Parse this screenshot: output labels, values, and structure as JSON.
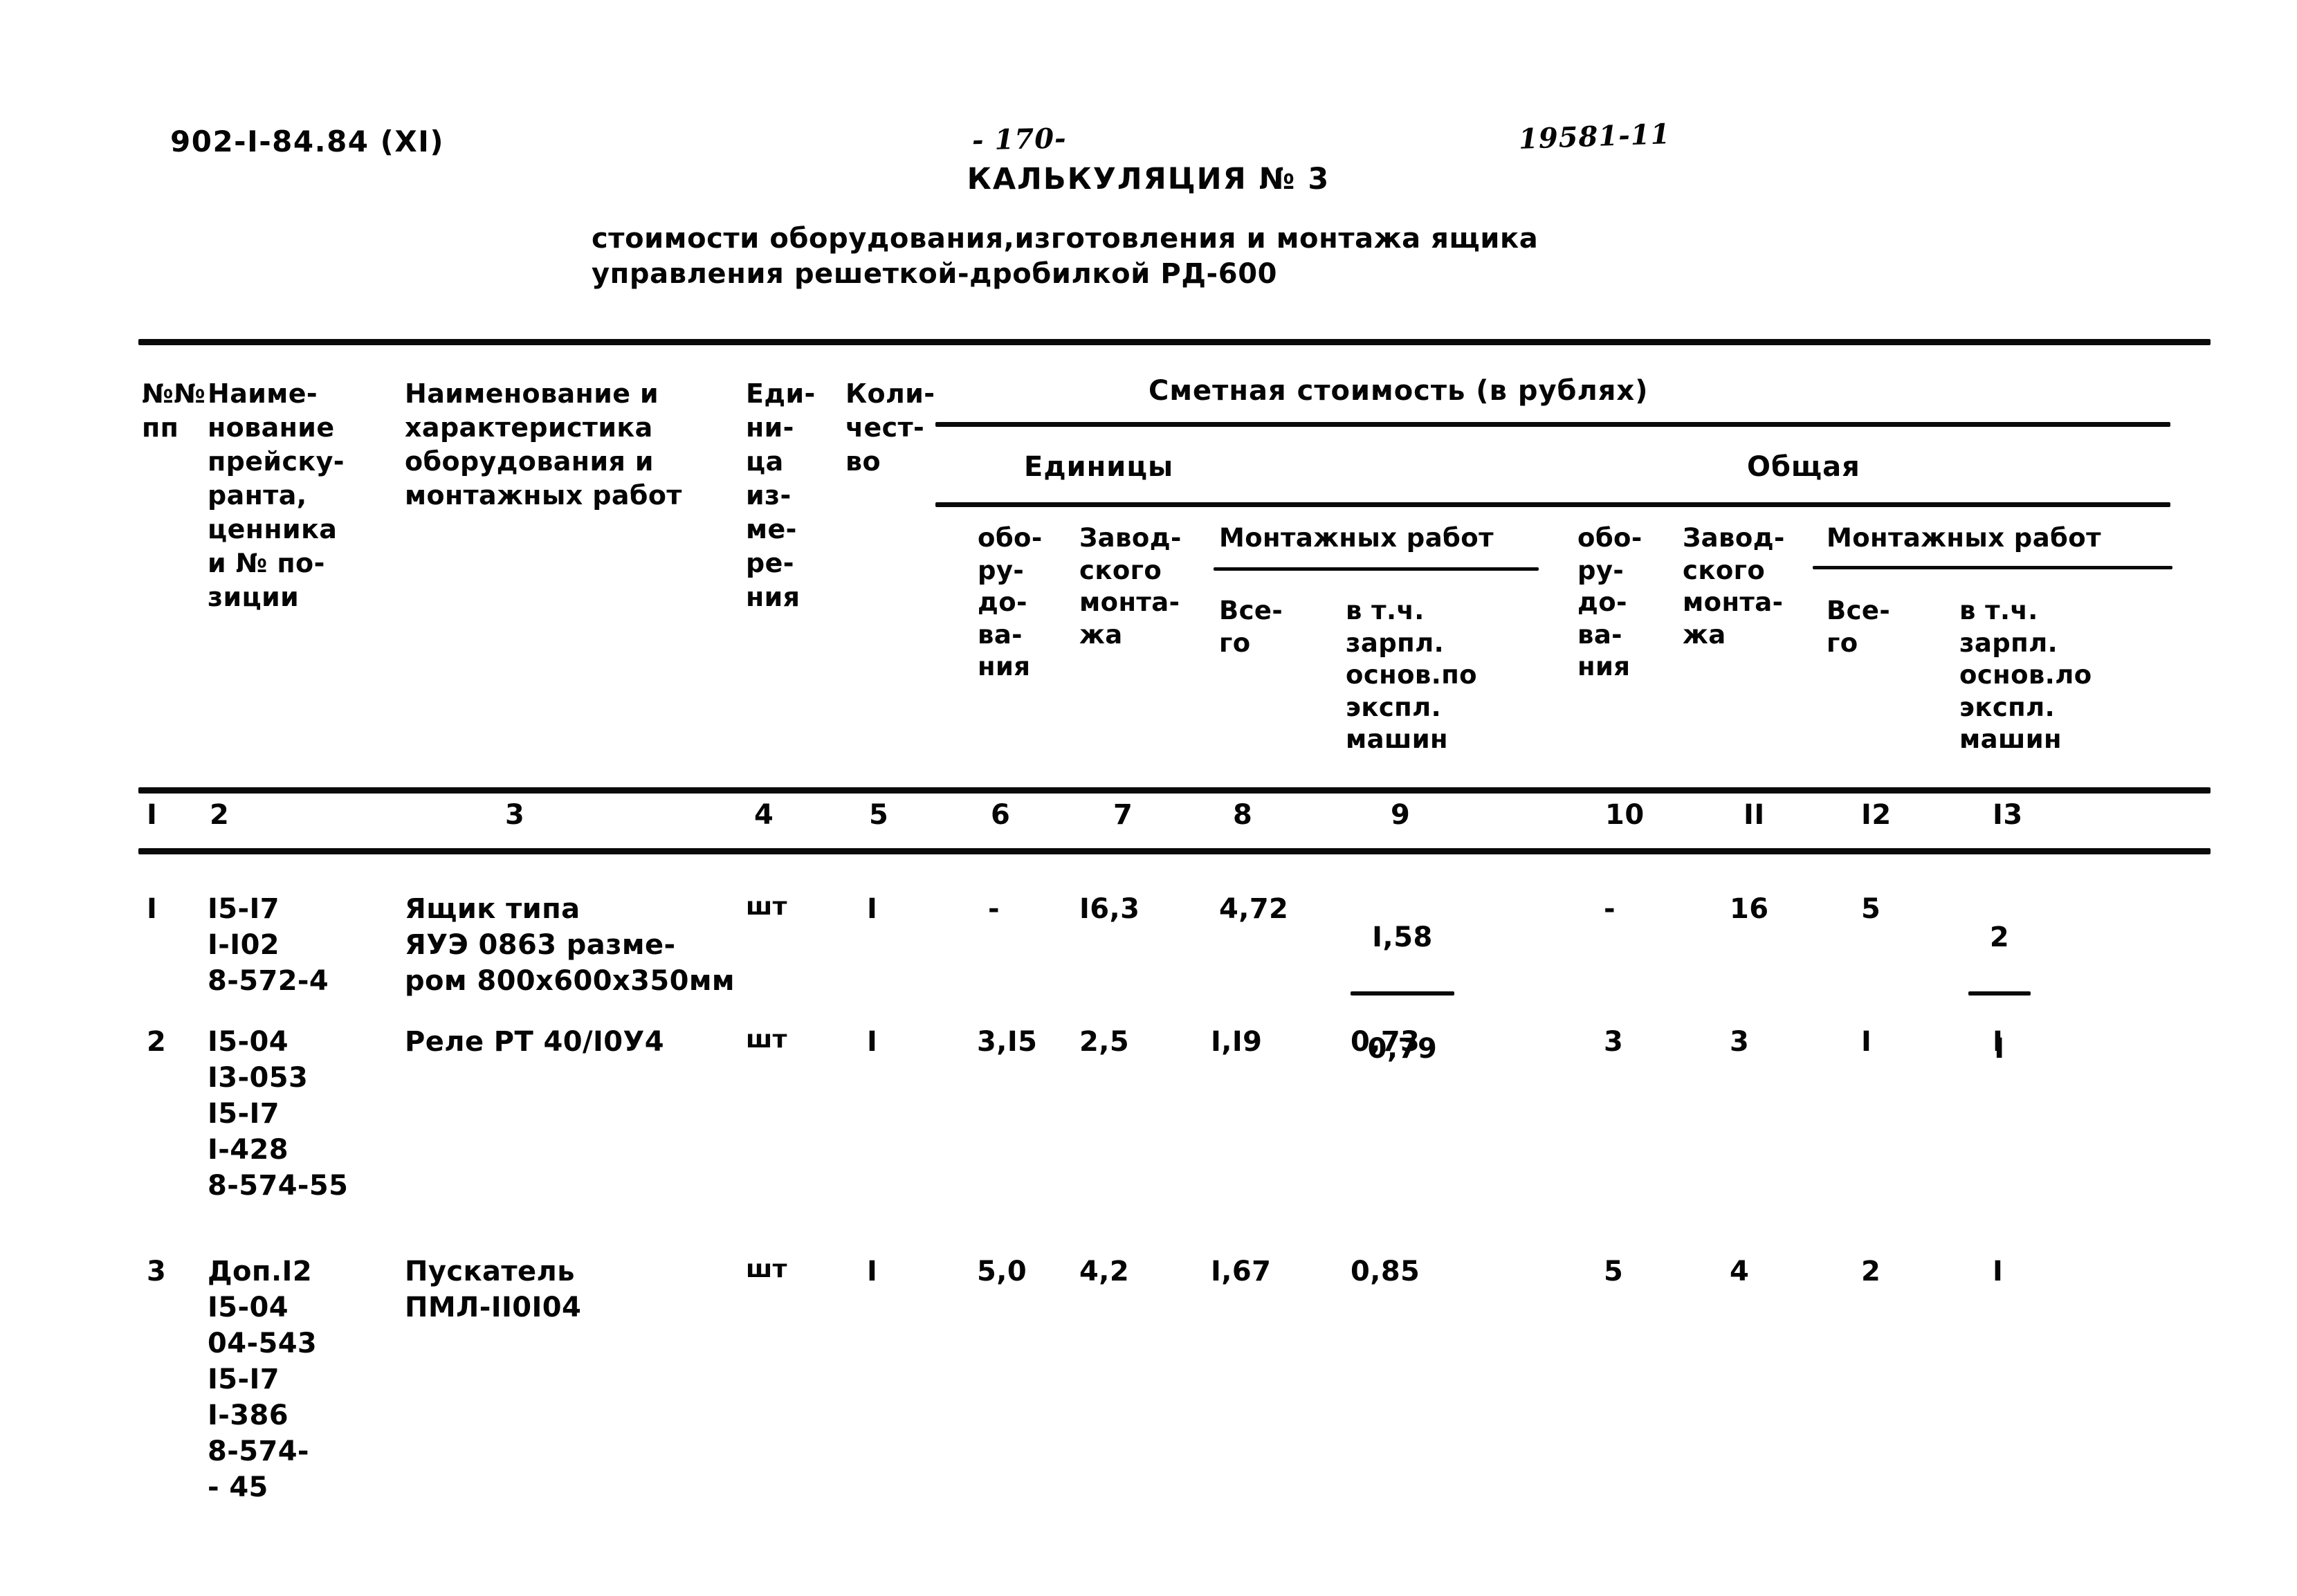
{
  "header": {
    "doc_code": "902-I-84.84  (XI)",
    "page_number": "- 170-",
    "archive_number": "19581-11",
    "calc_title": "КАЛЬКУЛЯЦИЯ № 3",
    "calc_subtitle": "стоимости оборудования,изготовления и монтажа ящика\nуправления решеткой-дробилкой  РД-600"
  },
  "table": {
    "headers": {
      "col1": "№№\nпп",
      "col2": "Наиме-\nнование\nпрейску-\nранта,\nценника\nи № по-\nзиции",
      "col3": "Наименование и\nхарактеристика\nоборудования и\nмонтажных работ",
      "col4": "Еди-\nни-\nца\nиз-\nме-\nре-\nния",
      "col5": "Коли-\nчест-\nво",
      "cost_group": "Сметная стоимость  (в рублях)",
      "unit_group": "Единицы",
      "total_group": "Общая",
      "col6": "обо-\nру-\nдо-\nва-\nния",
      "col7": "Завод-\nского\nмонта-\nжа",
      "mount_left": "Монтажных работ",
      "col8": "Все-\nго",
      "col9": "в т.ч.\nзарпл.\nоснов.по\nэкспл.\nмашин",
      "col10": "обо-\nру-\nдо-\nва-\nния",
      "col11": "Завод-\nского\nмонта-\nжа",
      "mount_right": "Монтажных работ",
      "col12": "Все-\nго",
      "col13": "в т.ч.\nзарпл.\nоснов.ло\nэкспл.\nмашин"
    },
    "column_numbers": [
      "I",
      "2",
      "3",
      "4",
      "5",
      "6",
      "7",
      "8",
      "9",
      "10",
      "II",
      "I2",
      "I3"
    ],
    "rows": [
      {
        "no": "I",
        "price_ref": "I5-I7\nI-I02\n8-572-4",
        "description": "Ящик типа\nЯУЭ 0863 разме-\nром 800х600х350мм",
        "unit": "шт",
        "qty": "I",
        "unit_equip": "-",
        "unit_factory": "I6,3",
        "unit_mount_total": "4,72",
        "unit_mount_salary_top": "I,58",
        "unit_mount_salary_bottom": "0,79",
        "total_equip": "-",
        "total_factory": "16",
        "total_mount_total": "5",
        "total_mount_salary_top": "2",
        "total_mount_salary_bottom": "I"
      },
      {
        "no": "2",
        "price_ref": "I5-04\nI3-053\nI5-I7\nI-428\n8-574-55",
        "description": "Реле РТ 40/I0У4",
        "unit": "шт",
        "qty": "I",
        "unit_equip": "3,I5",
        "unit_factory": "2,5",
        "unit_mount_total": "I,I9",
        "unit_mount_salary": "0,73",
        "total_equip": "3",
        "total_factory": "3",
        "total_mount_total": "I",
        "total_mount_salary": "I"
      },
      {
        "no": "3",
        "price_ref": "Доп.I2\nI5-04\n04-543\nI5-I7\nI-386\n8-574-\n- 45",
        "description": "Пускатель\nПМЛ-II0I04",
        "unit": "шт",
        "qty": "I",
        "unit_equip": "5,0",
        "unit_factory": "4,2",
        "unit_mount_total": "I,67",
        "unit_mount_salary": "0,85",
        "total_equip": "5",
        "total_factory": "4",
        "total_mount_total": "2",
        "total_mount_salary": "I"
      }
    ]
  }
}
